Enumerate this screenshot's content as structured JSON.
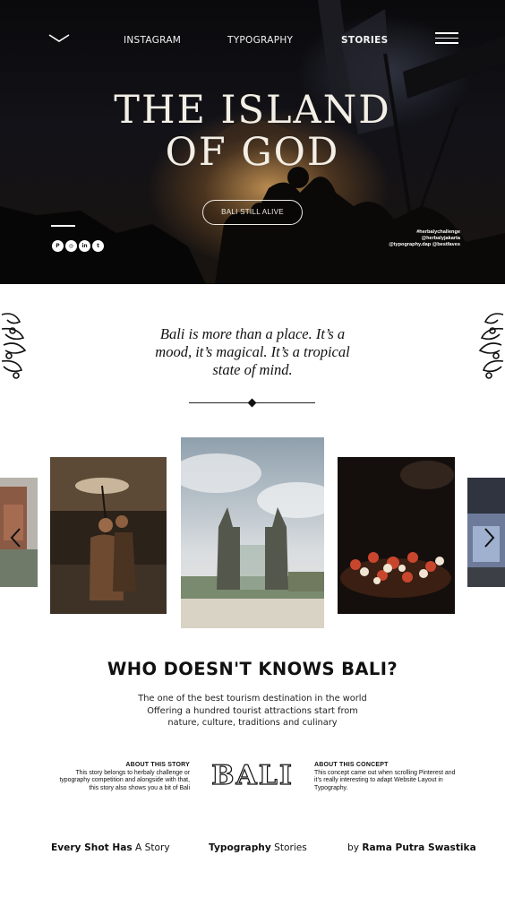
{
  "nav": {
    "links": [
      {
        "label": "INSTAGRAM",
        "active": false
      },
      {
        "label": "TYPOGRAPHY",
        "active": false
      },
      {
        "label": "STORIES",
        "active": true
      }
    ]
  },
  "hero": {
    "title_line1": "The Island",
    "title_line2": "of God",
    "button_label": "BALI STILL ALIVE",
    "socials": [
      {
        "icon": "pinterest-icon",
        "glyph": "P"
      },
      {
        "icon": "instagram-icon",
        "glyph": "◎"
      },
      {
        "icon": "linkedin-icon",
        "glyph": "in"
      },
      {
        "icon": "twitter-icon",
        "glyph": "t"
      }
    ],
    "hashtags": [
      "#herbalychallenge",
      "@herbalyjakarta",
      "@typography.dap @bestfaves"
    ]
  },
  "quote": {
    "text": "Bali is more than a place. It’s a mood, it’s magical. It’s a tropical state of mind."
  },
  "section": {
    "title": "WHO DOESN'T KNOWS BALI?",
    "desc_line1": "The one of the best tourism destination in the world",
    "desc_line2": "Offering a hundred tourist attractions start from",
    "desc_line3": "nature, culture, traditions and culinary"
  },
  "about_story": {
    "heading": "ABOUT THIS STORY",
    "text": "This story belongs to herbaly challenge or typography competition and alongside with that, this story also shows you a bit of Bali"
  },
  "about_concept": {
    "heading": "ABOUT THIS CONCEPT",
    "text": "This concept came out when scrolling Pinterest and it’s really interesting to adapt Website Layout in Typography."
  },
  "logo_text": "BALI",
  "footer": {
    "left_bold": "Every Shot Has",
    "left_rest": " A Story",
    "mid_bold": "Typography",
    "mid_rest": " Stories",
    "right_pre": "by ",
    "right_bold": "Rama Putra Swastika"
  }
}
